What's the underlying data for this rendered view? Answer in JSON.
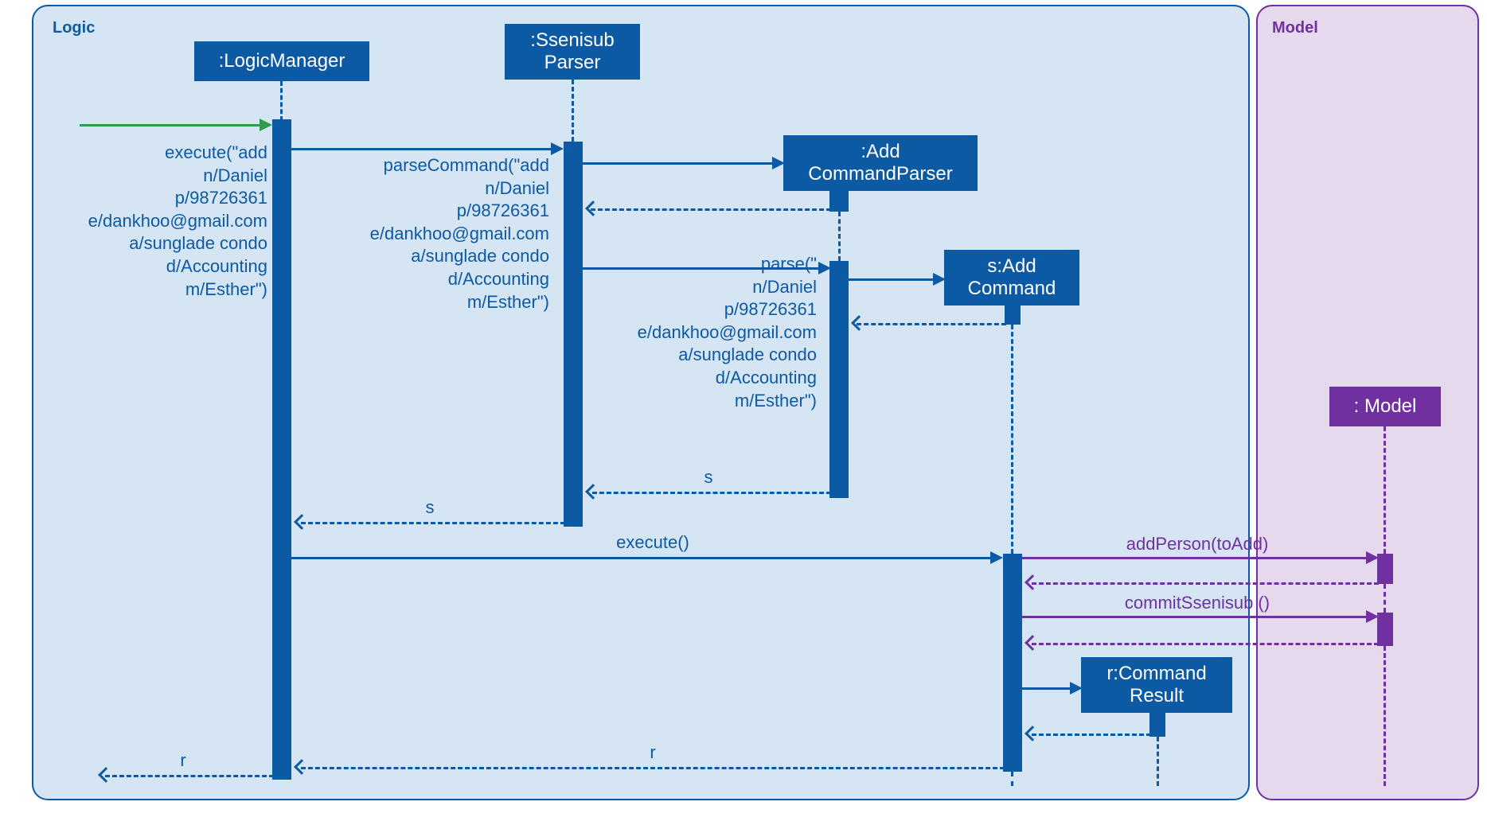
{
  "frames": {
    "logic": {
      "label": "Logic"
    },
    "model": {
      "label": "Model"
    }
  },
  "lifelines": {
    "logic_manager": {
      "header": ":LogicManager"
    },
    "ssenisub_parser": {
      "header": ":Ssenisub\nParser"
    },
    "add_command_parser": {
      "header": ":Add\nCommandParser"
    },
    "add_command": {
      "header": "s:Add\nCommand"
    },
    "command_result": {
      "header": "r:Command\nResult"
    },
    "model": {
      "header": ": Model"
    }
  },
  "messages": {
    "execute_add": "execute(\"add\nn/Daniel\np/98726361\ne/dankhoo@gmail.com\na/sunglade condo\nd/Accounting\nm/Esther\")",
    "parse_command": "parseCommand(\"add\nn/Daniel\np/98726361\ne/dankhoo@gmail.com\na/sunglade condo\nd/Accounting\nm/Esther\")",
    "parse": "parse(\"\nn/Daniel\np/98726361\ne/dankhoo@gmail.com\na/sunglade condo\nd/Accounting\nm/Esther\")",
    "return_s1": "s",
    "return_s2": "s",
    "execute_call": "execute()",
    "add_person": "addPerson(toAdd)",
    "commit_ssenisub": "commitSsenisub ()",
    "return_r1": "r",
    "return_r2": "r"
  }
}
